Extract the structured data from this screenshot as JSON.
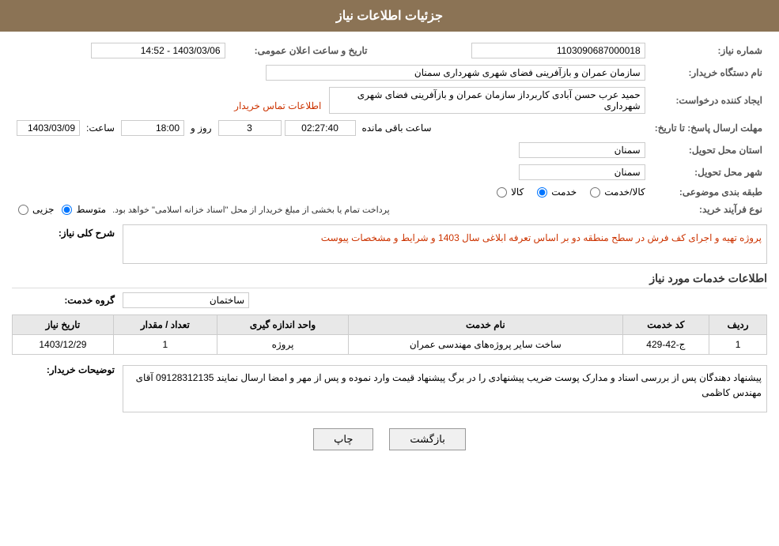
{
  "header": {
    "title": "جزئیات اطلاعات نیاز"
  },
  "fields": {
    "shomara_niaz_label": "شماره نیاز:",
    "shomara_niaz_value": "1103090687000018",
    "name_dastgah_label": "نام دستگاه خریدار:",
    "name_dastgah_value": "سازمان عمران و بازآفرینی فضای شهری شهرداری سمنان",
    "ijad_label": "ایجاد کننده درخواست:",
    "ijad_value": "حمید عرب حسن آبادی کاربرداز سازمان عمران و بازآفرینی فضای شهری شهرداری",
    "ijad_link": "اطلاعات تماس خریدار",
    "mohlat_label": "مهلت ارسال پاسخ: تا تاریخ:",
    "tarikh_value": "1403/03/09",
    "saaat_label": "ساعت:",
    "saaat_value": "18:00",
    "rooz_label": "روز و",
    "rooz_value": "3",
    "baqi_label": "ساعت باقی مانده",
    "baqi_value": "02:27:40",
    "tarikh_aalan_label": "تاریخ و ساعت اعلان عمومی:",
    "tarikh_aalan_value": "1403/03/06 - 14:52",
    "ostan_tahvil_label": "استان محل تحویل:",
    "ostan_tahvil_value": "سمنان",
    "shahr_tahvil_label": "شهر محل تحویل:",
    "shahr_tahvil_value": "سمنان",
    "tabaqe_label": "طبقه بندی موضوعی:",
    "nooe_farayand_label": "نوع فرآیند خرید:",
    "nooe_farayand_note": "پرداخت تمام یا بخشی از مبلغ خریدار از محل \"اسناد خزانه اسلامی\" خواهد بود.",
    "sharh_koli_label": "شرح کلی نیاز:",
    "sharh_koli_value": "پروژه تهیه و اجرای کف فرش در سطح منطقه دو بر اساس تعرفه ابلاغی سال 1403 و شرایط و مشخصات پیوست",
    "ettelaat_khadamat_label": "اطلاعات خدمات مورد نیاز",
    "gorooh_khadamat_label": "گروه خدمت:",
    "gorooh_khadamat_value": "ساختمان",
    "table": {
      "headers": [
        "ردیف",
        "کد خدمت",
        "نام خدمت",
        "واحد اندازه گیری",
        "تعداد / مقدار",
        "تاریخ نیاز"
      ],
      "rows": [
        {
          "radif": "1",
          "kod": "ج-42-429",
          "name": "ساخت سایر پروژه‌های مهندسی عمران",
          "vahed": "پروژه",
          "tedad": "1",
          "tarikh": "1403/12/29"
        }
      ]
    },
    "toozihat_label": "توضیحات خریدار:",
    "toozihat_value": "پیشنهاد دهندگان پس از بررسی اسناد و مدارک پوست ضریب  پیشنهادی را در برگ پیشنهاد قیمت وارد نموده و پس از مهر و امضا ارسال نمایند 09128312135 آقای مهندس کاظمی",
    "radio_tabaqe": [
      {
        "label": "کالا",
        "value": "kala",
        "checked": false
      },
      {
        "label": "خدمت",
        "value": "khadamat",
        "checked": true
      },
      {
        "label": "کالا/خدمت",
        "value": "kala_khadamat",
        "checked": false
      }
    ],
    "radio_farayand": [
      {
        "label": "جزیی",
        "value": "jozi",
        "checked": false
      },
      {
        "label": "متوسط",
        "value": "motovaset",
        "checked": true
      },
      {
        "label": "",
        "value": "other",
        "checked": false
      }
    ]
  },
  "buttons": {
    "back_label": "بازگشت",
    "print_label": "چاپ"
  }
}
